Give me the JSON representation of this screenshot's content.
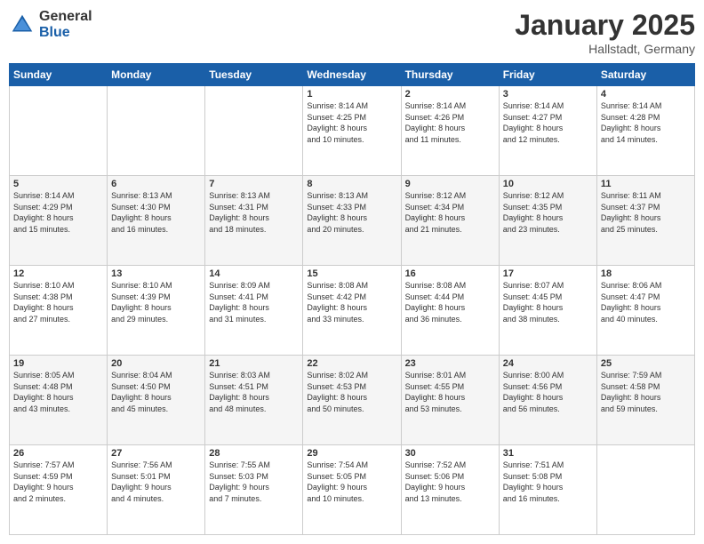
{
  "logo": {
    "general": "General",
    "blue": "Blue"
  },
  "header": {
    "month": "January 2025",
    "location": "Hallstadt, Germany"
  },
  "weekdays": [
    "Sunday",
    "Monday",
    "Tuesday",
    "Wednesday",
    "Thursday",
    "Friday",
    "Saturday"
  ],
  "weeks": [
    [
      {
        "day": "",
        "info": ""
      },
      {
        "day": "",
        "info": ""
      },
      {
        "day": "",
        "info": ""
      },
      {
        "day": "1",
        "info": "Sunrise: 8:14 AM\nSunset: 4:25 PM\nDaylight: 8 hours\nand 10 minutes."
      },
      {
        "day": "2",
        "info": "Sunrise: 8:14 AM\nSunset: 4:26 PM\nDaylight: 8 hours\nand 11 minutes."
      },
      {
        "day": "3",
        "info": "Sunrise: 8:14 AM\nSunset: 4:27 PM\nDaylight: 8 hours\nand 12 minutes."
      },
      {
        "day": "4",
        "info": "Sunrise: 8:14 AM\nSunset: 4:28 PM\nDaylight: 8 hours\nand 14 minutes."
      }
    ],
    [
      {
        "day": "5",
        "info": "Sunrise: 8:14 AM\nSunset: 4:29 PM\nDaylight: 8 hours\nand 15 minutes."
      },
      {
        "day": "6",
        "info": "Sunrise: 8:13 AM\nSunset: 4:30 PM\nDaylight: 8 hours\nand 16 minutes."
      },
      {
        "day": "7",
        "info": "Sunrise: 8:13 AM\nSunset: 4:31 PM\nDaylight: 8 hours\nand 18 minutes."
      },
      {
        "day": "8",
        "info": "Sunrise: 8:13 AM\nSunset: 4:33 PM\nDaylight: 8 hours\nand 20 minutes."
      },
      {
        "day": "9",
        "info": "Sunrise: 8:12 AM\nSunset: 4:34 PM\nDaylight: 8 hours\nand 21 minutes."
      },
      {
        "day": "10",
        "info": "Sunrise: 8:12 AM\nSunset: 4:35 PM\nDaylight: 8 hours\nand 23 minutes."
      },
      {
        "day": "11",
        "info": "Sunrise: 8:11 AM\nSunset: 4:37 PM\nDaylight: 8 hours\nand 25 minutes."
      }
    ],
    [
      {
        "day": "12",
        "info": "Sunrise: 8:10 AM\nSunset: 4:38 PM\nDaylight: 8 hours\nand 27 minutes."
      },
      {
        "day": "13",
        "info": "Sunrise: 8:10 AM\nSunset: 4:39 PM\nDaylight: 8 hours\nand 29 minutes."
      },
      {
        "day": "14",
        "info": "Sunrise: 8:09 AM\nSunset: 4:41 PM\nDaylight: 8 hours\nand 31 minutes."
      },
      {
        "day": "15",
        "info": "Sunrise: 8:08 AM\nSunset: 4:42 PM\nDaylight: 8 hours\nand 33 minutes."
      },
      {
        "day": "16",
        "info": "Sunrise: 8:08 AM\nSunset: 4:44 PM\nDaylight: 8 hours\nand 36 minutes."
      },
      {
        "day": "17",
        "info": "Sunrise: 8:07 AM\nSunset: 4:45 PM\nDaylight: 8 hours\nand 38 minutes."
      },
      {
        "day": "18",
        "info": "Sunrise: 8:06 AM\nSunset: 4:47 PM\nDaylight: 8 hours\nand 40 minutes."
      }
    ],
    [
      {
        "day": "19",
        "info": "Sunrise: 8:05 AM\nSunset: 4:48 PM\nDaylight: 8 hours\nand 43 minutes."
      },
      {
        "day": "20",
        "info": "Sunrise: 8:04 AM\nSunset: 4:50 PM\nDaylight: 8 hours\nand 45 minutes."
      },
      {
        "day": "21",
        "info": "Sunrise: 8:03 AM\nSunset: 4:51 PM\nDaylight: 8 hours\nand 48 minutes."
      },
      {
        "day": "22",
        "info": "Sunrise: 8:02 AM\nSunset: 4:53 PM\nDaylight: 8 hours\nand 50 minutes."
      },
      {
        "day": "23",
        "info": "Sunrise: 8:01 AM\nSunset: 4:55 PM\nDaylight: 8 hours\nand 53 minutes."
      },
      {
        "day": "24",
        "info": "Sunrise: 8:00 AM\nSunset: 4:56 PM\nDaylight: 8 hours\nand 56 minutes."
      },
      {
        "day": "25",
        "info": "Sunrise: 7:59 AM\nSunset: 4:58 PM\nDaylight: 8 hours\nand 59 minutes."
      }
    ],
    [
      {
        "day": "26",
        "info": "Sunrise: 7:57 AM\nSunset: 4:59 PM\nDaylight: 9 hours\nand 2 minutes."
      },
      {
        "day": "27",
        "info": "Sunrise: 7:56 AM\nSunset: 5:01 PM\nDaylight: 9 hours\nand 4 minutes."
      },
      {
        "day": "28",
        "info": "Sunrise: 7:55 AM\nSunset: 5:03 PM\nDaylight: 9 hours\nand 7 minutes."
      },
      {
        "day": "29",
        "info": "Sunrise: 7:54 AM\nSunset: 5:05 PM\nDaylight: 9 hours\nand 10 minutes."
      },
      {
        "day": "30",
        "info": "Sunrise: 7:52 AM\nSunset: 5:06 PM\nDaylight: 9 hours\nand 13 minutes."
      },
      {
        "day": "31",
        "info": "Sunrise: 7:51 AM\nSunset: 5:08 PM\nDaylight: 9 hours\nand 16 minutes."
      },
      {
        "day": "",
        "info": ""
      }
    ]
  ]
}
